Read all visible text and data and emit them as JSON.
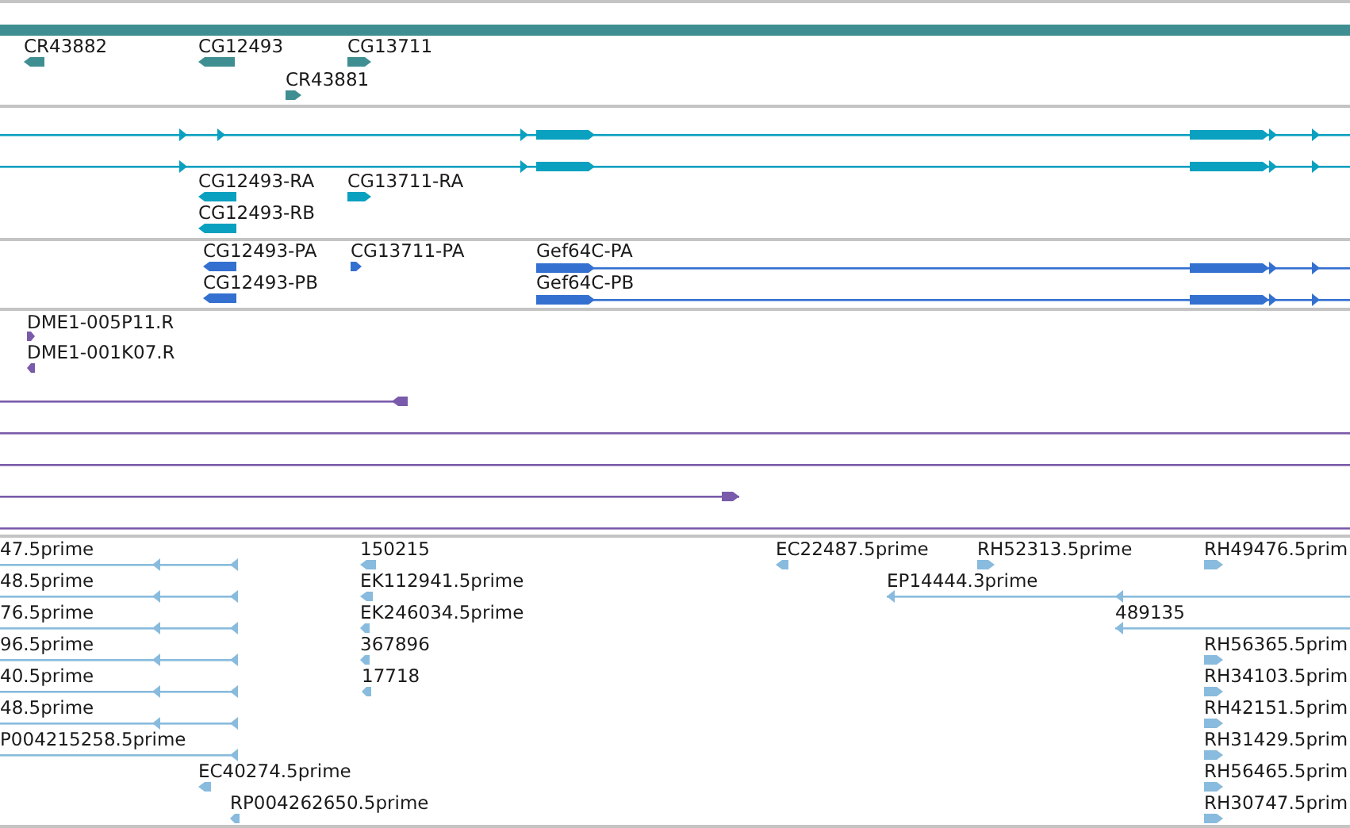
{
  "tracks": [
    {
      "color": "#3f8e92",
      "features": [
        {
          "kind": "span"
        },
        {
          "kind": "block",
          "label": "CR43882",
          "reverse": true
        },
        {
          "kind": "block",
          "label": "CG12493",
          "reverse": true
        },
        {
          "kind": "block",
          "label": "CG13711",
          "reverse": false
        },
        {
          "kind": "block",
          "label": "CR43881",
          "reverse": false
        }
      ]
    },
    {
      "color": "#0aa0c0",
      "features": [
        {
          "kind": "line",
          "reverse": false
        },
        {
          "kind": "line",
          "reverse": false
        },
        {
          "kind": "block",
          "label": "CG12493-RA",
          "reverse": true
        },
        {
          "kind": "block",
          "label": "CG13711-RA",
          "reverse": false
        },
        {
          "kind": "block",
          "label": "CG12493-RB",
          "reverse": true
        }
      ]
    },
    {
      "color": "#3370d0",
      "features": [
        {
          "kind": "block",
          "label": "CG12493-PA",
          "reverse": true
        },
        {
          "kind": "block",
          "label": "CG13711-PA",
          "reverse": false
        },
        {
          "kind": "line",
          "label": "Gef64C-PA",
          "reverse": false
        },
        {
          "kind": "block",
          "label": "CG12493-PB",
          "reverse": true
        },
        {
          "kind": "line",
          "label": "Gef64C-PB",
          "reverse": false
        }
      ]
    },
    {
      "color": "#7a5aaa",
      "features": [
        {
          "kind": "block",
          "label": "DME1-005P11.R",
          "reverse": false
        },
        {
          "kind": "block",
          "label": "DME1-001K07.R",
          "reverse": true
        },
        {
          "kind": "line",
          "reverse": true
        },
        {
          "kind": "line"
        },
        {
          "kind": "line"
        },
        {
          "kind": "line",
          "reverse": false
        },
        {
          "kind": "line"
        }
      ]
    },
    {
      "color": "#88bbdd",
      "features": [
        {
          "kind": "line",
          "label": "47.5prime",
          "reverse": true
        },
        {
          "kind": "block",
          "label": "150215",
          "reverse": true
        },
        {
          "kind": "block",
          "label": "EC22487.5prime",
          "reverse": true
        },
        {
          "kind": "block",
          "label": "RH52313.5prime",
          "reverse": false
        },
        {
          "kind": "block",
          "label": "RH49476.5prim",
          "reverse": false
        },
        {
          "kind": "line",
          "label": "48.5prime",
          "reverse": true
        },
        {
          "kind": "block",
          "label": "EK112941.5prime",
          "reverse": true
        },
        {
          "kind": "line",
          "label": "EP14444.3prime",
          "reverse": true
        },
        {
          "kind": "line",
          "label": "76.5prime",
          "reverse": true
        },
        {
          "kind": "block",
          "label": "EK246034.5prime",
          "reverse": true
        },
        {
          "kind": "line",
          "label": "489135",
          "reverse": true
        },
        {
          "kind": "line",
          "label": "96.5prime",
          "reverse": true
        },
        {
          "kind": "block",
          "label": "367896",
          "reverse": true
        },
        {
          "kind": "block",
          "label": "RH56365.5prim",
          "reverse": false
        },
        {
          "kind": "line",
          "label": "40.5prime",
          "reverse": true
        },
        {
          "kind": "block",
          "label": "17718",
          "reverse": true
        },
        {
          "kind": "block",
          "label": "RH34103.5prim",
          "reverse": false
        },
        {
          "kind": "line",
          "label": "48.5prime",
          "reverse": true
        },
        {
          "kind": "block",
          "label": "RH42151.5prim",
          "reverse": false
        },
        {
          "kind": "line",
          "label": "P004215258.5prime",
          "reverse": true
        },
        {
          "kind": "block",
          "label": "RH31429.5prim",
          "reverse": false
        },
        {
          "kind": "block",
          "label": "EC40274.5prime",
          "reverse": true
        },
        {
          "kind": "block",
          "label": "RH56465.5prim",
          "reverse": false
        },
        {
          "kind": "block",
          "label": "RP004262650.5prime",
          "reverse": true
        },
        {
          "kind": "block",
          "label": "RH30747.5prim",
          "reverse": false
        }
      ]
    }
  ]
}
